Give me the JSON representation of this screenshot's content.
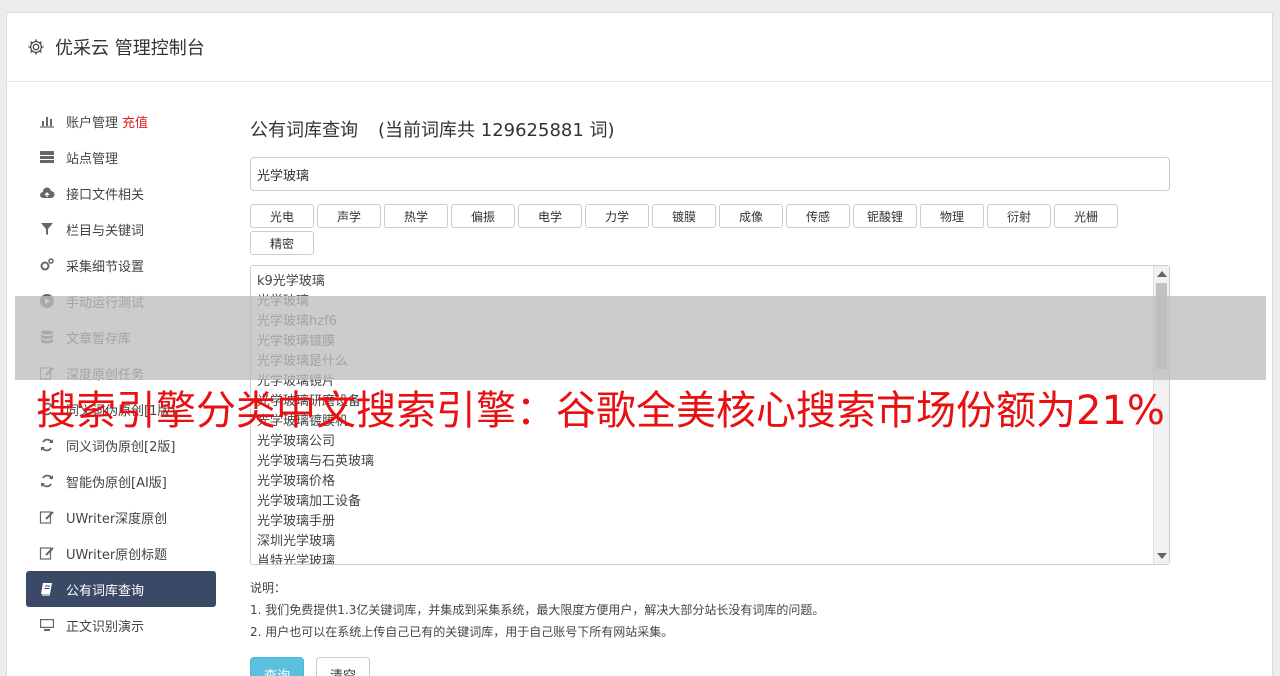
{
  "app": {
    "title": "优采云 管理控制台"
  },
  "sidebar": {
    "items": [
      {
        "label": "账户管理",
        "extra": "充值",
        "icon": "bar-chart-icon"
      },
      {
        "label": "站点管理",
        "icon": "server-icon"
      },
      {
        "label": "接口文件相关",
        "icon": "cloud-upload-icon"
      },
      {
        "label": "栏目与关键词",
        "icon": "filter-icon"
      },
      {
        "label": "采集细节设置",
        "icon": "gears-icon"
      },
      {
        "label": "手动运行测试",
        "icon": "play-circle-icon"
      },
      {
        "label": "文章暂存库",
        "icon": "database-icon"
      },
      {
        "label": "深度原创任务",
        "icon": "edit-icon"
      },
      {
        "label": "同义词伪原创[1版]",
        "icon": "refresh-icon"
      },
      {
        "label": "同义词伪原创[2版]",
        "icon": "refresh-icon"
      },
      {
        "label": "智能伪原创[AI版]",
        "icon": "refresh-icon"
      },
      {
        "label": "UWriter深度原创",
        "icon": "edit-icon"
      },
      {
        "label": "UWriter原创标题",
        "icon": "edit-icon"
      },
      {
        "label": "公有词库查询",
        "icon": "book-icon",
        "active": true
      },
      {
        "label": "正文识别演示",
        "icon": "monitor-icon"
      }
    ]
  },
  "main": {
    "heading": "公有词库查询",
    "count_text": "(当前词库共 129625881 词)",
    "search_value": "光学玻璃",
    "tags": [
      "光电",
      "声学",
      "热学",
      "偏振",
      "电学",
      "力学",
      "镀膜",
      "成像",
      "传感",
      "铌酸锂",
      "物理",
      "衍射",
      "光栅",
      "精密"
    ],
    "results": [
      "k9光学玻璃",
      "光学玻璃",
      "光学玻璃hzf6",
      "光学玻璃镀膜",
      "光学玻璃是什么",
      "光学玻璃镜片",
      "光学玻璃研磨设备",
      "光学玻璃镀膜机",
      "光学玻璃公司",
      "光学玻璃与石英玻璃",
      "光学玻璃价格",
      "光学玻璃加工设备",
      "光学玻璃手册",
      "深圳光学玻璃",
      "肖特光学玻璃"
    ],
    "notes": {
      "title": "说明：",
      "lines": [
        "1. 我们免费提供1.3亿关键词库，并集成到采集系统，最大限度方便用户，解决大部分站长没有词库的问题。",
        "2. 用户也可以在系统上传自己已有的关键词库，用于自己账号下所有网站采集。"
      ]
    },
    "buttons": {
      "query": "查询",
      "clear": "清空"
    }
  },
  "overlay": {
    "banner_text": "搜索引擎分类中文搜索引擎：谷歌全美核心搜索市场份额为21%"
  },
  "colors": {
    "active_nav_bg": "#3a4a66",
    "recharge": "#e02020",
    "banner": "#e81010",
    "primary_button": "#5bc0de"
  }
}
